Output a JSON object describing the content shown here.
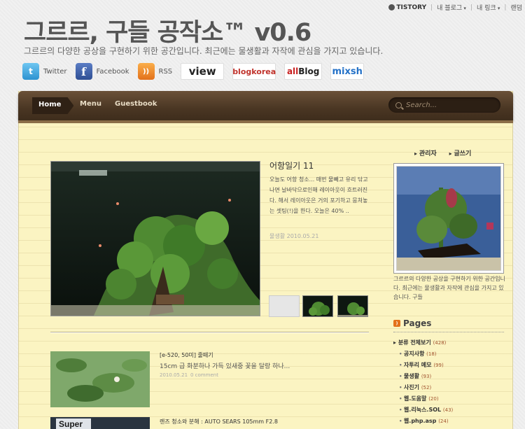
{
  "topbar": {
    "tistory_label": "TISTORY",
    "my_blog": "내 블로그",
    "my_link": "내 링크",
    "random": "랜덤"
  },
  "header": {
    "title": "그르르, 구들 공작소™ v0.6",
    "description": "그르르의 다양한 공상을 구현하기 위한 공간입니다. 최근에는 물생활과 자작에 관심을 가지고 있습니다."
  },
  "social": {
    "twitter": "Twitter",
    "facebook": "Facebook",
    "rss": "RSS",
    "view": "view",
    "blogkorea": "blogkorea",
    "allblog_a": "all",
    "allblog_b": "Blog",
    "mixsh": "mixsh"
  },
  "nav": {
    "home": "Home",
    "menu": "Menu",
    "guestbook": "Guestbook",
    "search_placeholder": "Search..."
  },
  "featured": {
    "title": "어항일기 11",
    "body": "오늘도 어항 청소... 매번 물빼고 유리 닦고 나면 날바닥으로인해 레이아웃이 흐트러진다. 해서 레이아웃은 거의 포기하고 뭉쳐놓는 셋팅(!)을 한다. 오늘은 40% ..",
    "meta": "물생활   2010.05.21"
  },
  "posts": [
    {
      "title": "[e-520, 50미] 줄떼기",
      "excerpt": "15cm 급 화분하나 가득 있새중 꽃을 달랑 하나...",
      "date": "2010.05.21",
      "comments": "0 comment"
    },
    {
      "title": "렌즈 청소와 분해 : AUTO SEARS 105mm F2.8"
    }
  ],
  "sidebar": {
    "admin": "관리자",
    "write": "글쓰기",
    "profile_desc": "그르르의 다양한 공상을 구현하기 위한 공간입니다. 최근에는 물생활과 자작에 관심을 가지고 있습니다. 구들",
    "pages_title": "Pages",
    "categories": [
      {
        "label": "분류 전체보기",
        "count": "(428)"
      },
      {
        "label": "공지사항",
        "count": "(18)"
      },
      {
        "label": "자투리 메모",
        "count": "(99)"
      },
      {
        "label": "물생활",
        "count": "(93)"
      },
      {
        "label": "사진기",
        "count": "(52)"
      },
      {
        "label": "웹.도움말",
        "count": "(20)"
      },
      {
        "label": "웹.리눅스.SOL",
        "count": "(43)"
      },
      {
        "label": "웹.php.asp",
        "count": "(24)"
      }
    ]
  },
  "colors": {
    "nav_brown": "#4a3623",
    "paper": "#fbf4c2",
    "count_color": "#a0522d"
  }
}
